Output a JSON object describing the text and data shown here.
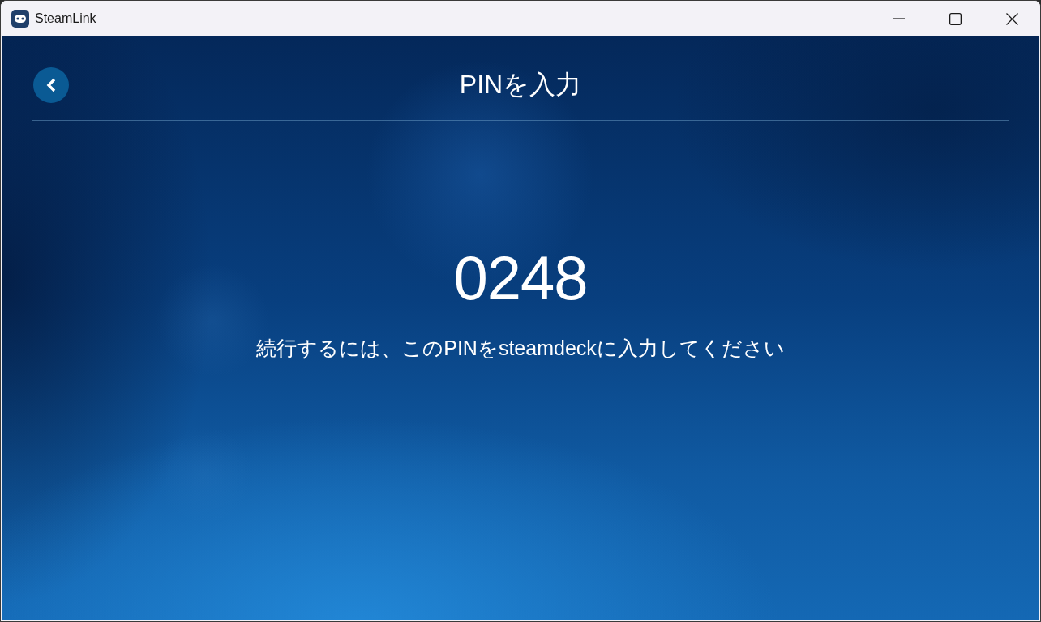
{
  "window": {
    "title": "SteamLink"
  },
  "header": {
    "title": "PINを入力"
  },
  "pin": {
    "code": "0248",
    "instruction": "続行するには、このPINをsteamdeckに入力してください"
  }
}
